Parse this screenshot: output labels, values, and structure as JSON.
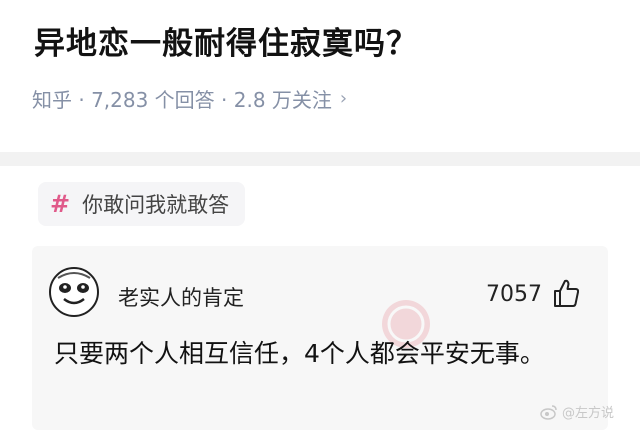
{
  "question": {
    "title": "异地恋一般耐得住寂寞吗？",
    "meta": "知乎 · 7,283 个回答 · 2.8 万关注",
    "meta_chevron": "›"
  },
  "topic": {
    "icon": "hash-icon",
    "label": "你敢问我就敢答"
  },
  "answer": {
    "author": "老实人的肯定",
    "likes": "7057",
    "like_icon": "thumbs-up-icon",
    "text": "只要两个人相互信任，4个人都会平安无事。"
  },
  "watermark": {
    "icon": "weibo-icon",
    "text": "@左方说"
  },
  "colors": {
    "accent_hash": "#e05a8a",
    "meta_gray": "#8590a6",
    "card_bg": "#f7f7f7"
  }
}
